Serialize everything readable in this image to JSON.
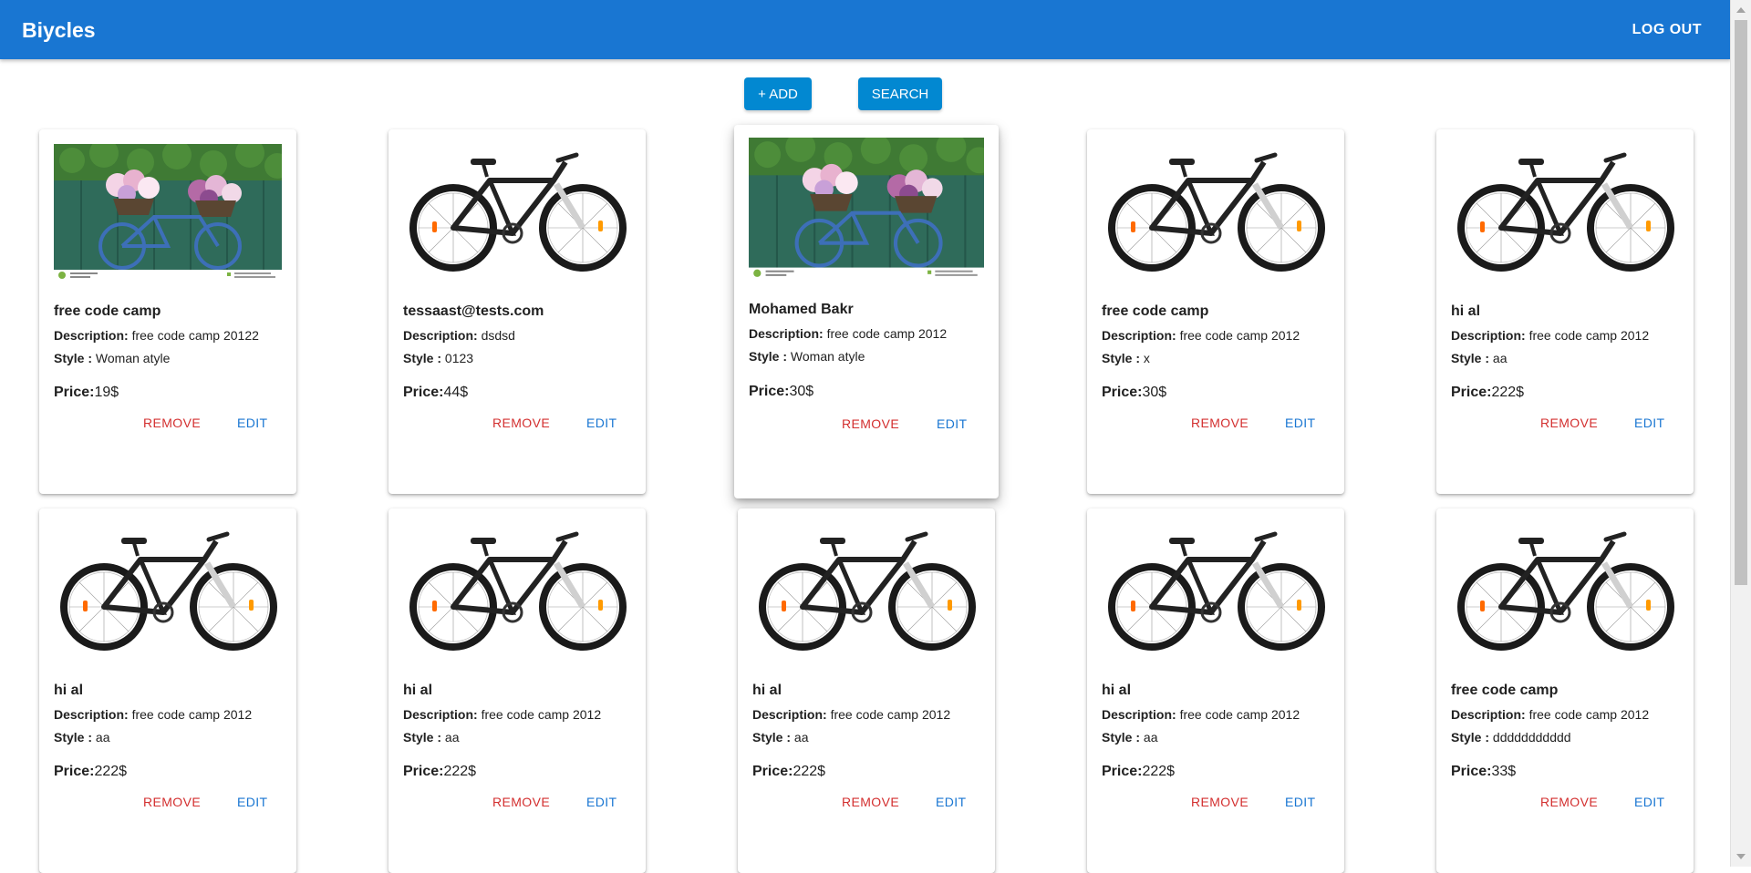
{
  "app": {
    "title": "Biycles",
    "logout_label": "LOG OUT"
  },
  "toolbar": {
    "add_label": "+ ADD",
    "search_label": "SEARCH"
  },
  "labels": {
    "description": "Description:",
    "style": "Style :",
    "price": "Price:",
    "remove": "REMOVE",
    "edit": "EDIT"
  },
  "colors": {
    "appbar": "#1976d2",
    "button": "#0288d1",
    "remove": "#d32f2f",
    "edit": "#1976d2"
  },
  "cards": [
    {
      "name": "free code camp",
      "description": "free code camp 20122",
      "style": "Woman atyle",
      "price": "19$",
      "image": "flower-basket-bicycle-photo"
    },
    {
      "name": "tessaast@tests.com",
      "description": "dsdsd",
      "style": "0123",
      "price": "44$",
      "image": "black-bicycle-photo"
    },
    {
      "name": "Mohamed Bakr",
      "description": "free code camp 2012",
      "style": "Woman atyle",
      "price": "30$",
      "image": "flower-basket-bicycle-photo"
    },
    {
      "name": "free code camp",
      "description": "free code camp 2012",
      "style": "x",
      "price": "30$",
      "image": "black-bicycle-photo"
    },
    {
      "name": "hi al",
      "description": "free code camp 2012",
      "style": "aa",
      "price": "222$",
      "image": "black-bicycle-photo"
    },
    {
      "name": "hi al",
      "description": "free code camp 2012",
      "style": "aa",
      "price": "222$",
      "image": "black-bicycle-photo"
    },
    {
      "name": "hi al",
      "description": "free code camp 2012",
      "style": "aa",
      "price": "222$",
      "image": "black-bicycle-photo"
    },
    {
      "name": "hi al",
      "description": "free code camp 2012",
      "style": "aa",
      "price": "222$",
      "image": "black-bicycle-photo"
    },
    {
      "name": "hi al",
      "description": "free code camp 2012",
      "style": "aa",
      "price": "222$",
      "image": "black-bicycle-photo"
    },
    {
      "name": "free code camp",
      "description": "free code camp 2012",
      "style": "ddddddddddd",
      "price": "33$",
      "image": "black-bicycle-photo"
    }
  ]
}
